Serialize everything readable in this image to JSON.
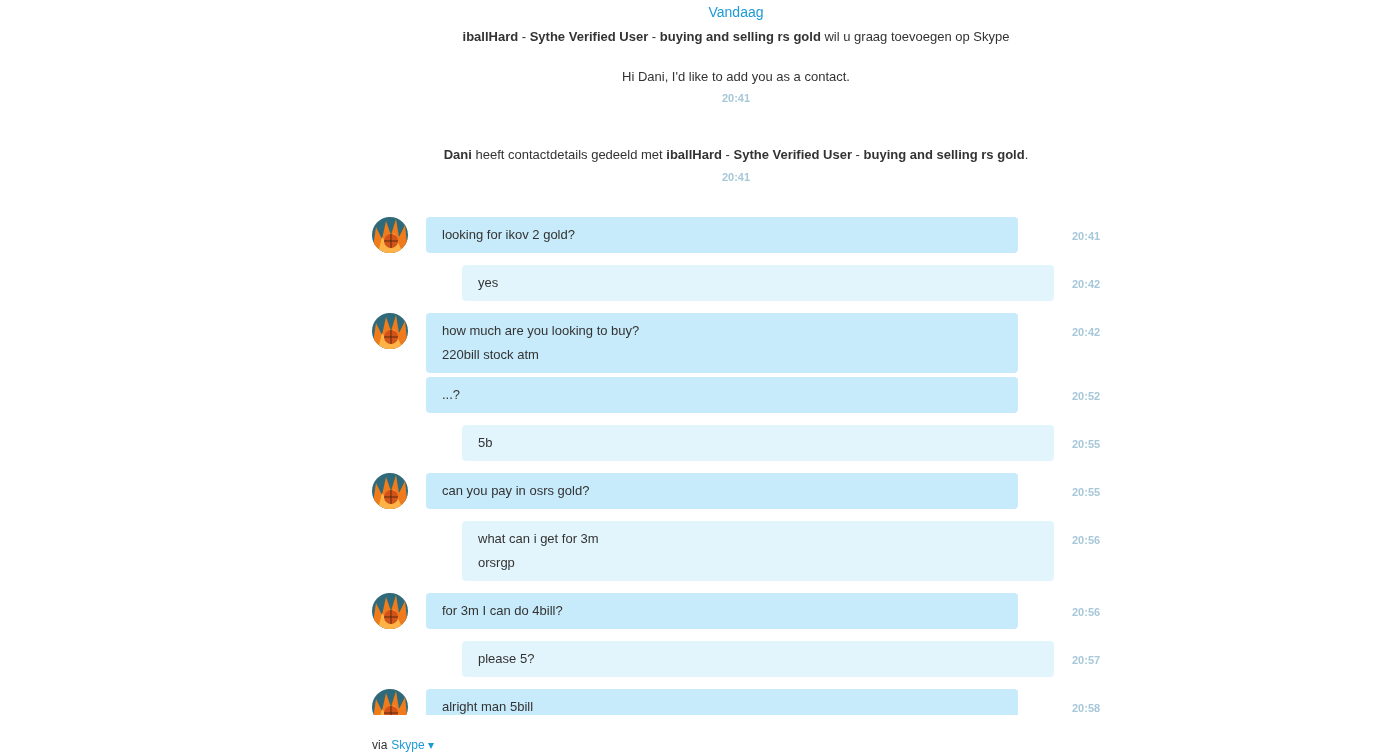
{
  "date_label": "Vandaag",
  "contact_request": {
    "text": "**iballHard** - **Sythe Verified User** - **buying and selling rs gold** wil u graag toevoegen op Skype",
    "greeting": "Hi Dani, I'd like to add you as a contact.",
    "time": "20:41"
  },
  "shared_notice": {
    "text": "**Dani** heeft contactdetails gedeeld met **iballHard** - **Sythe Verified User** - **buying and selling rs gold**.",
    "time": "20:41"
  },
  "messages": [
    {
      "kind": "incoming",
      "avatar": true,
      "lines": [
        "looking for ikov 2 gold?"
      ],
      "time": "20:41"
    },
    {
      "kind": "outgoing",
      "avatar": false,
      "lines": [
        "yes"
      ],
      "time": "20:42"
    },
    {
      "kind": "incoming",
      "avatar": true,
      "lines": [
        "how much are you looking to buy?",
        "220bill stock atm"
      ],
      "time": "20:42"
    },
    {
      "kind": "incoming",
      "avatar": false,
      "lines": [
        "...?"
      ],
      "time": "20:52"
    },
    {
      "kind": "outgoing",
      "avatar": false,
      "lines": [
        "5b"
      ],
      "time": "20:55"
    },
    {
      "kind": "incoming",
      "avatar": true,
      "lines": [
        "can you pay in osrs gold?"
      ],
      "time": "20:55"
    },
    {
      "kind": "outgoing",
      "avatar": false,
      "lines": [
        "what can i get for 3m",
        "orsrgp"
      ],
      "time": "20:56"
    },
    {
      "kind": "incoming",
      "avatar": true,
      "lines": [
        "for 3m I can do 4bill?"
      ],
      "time": "20:56"
    },
    {
      "kind": "outgoing",
      "avatar": false,
      "lines": [
        "please 5?"
      ],
      "time": "20:57"
    },
    {
      "kind": "incoming",
      "avatar": true,
      "lines": [
        "alright man 5bill"
      ],
      "time": "20:58"
    }
  ],
  "footer": {
    "prefix": "via",
    "link": "Skype",
    "caret": "▾"
  }
}
